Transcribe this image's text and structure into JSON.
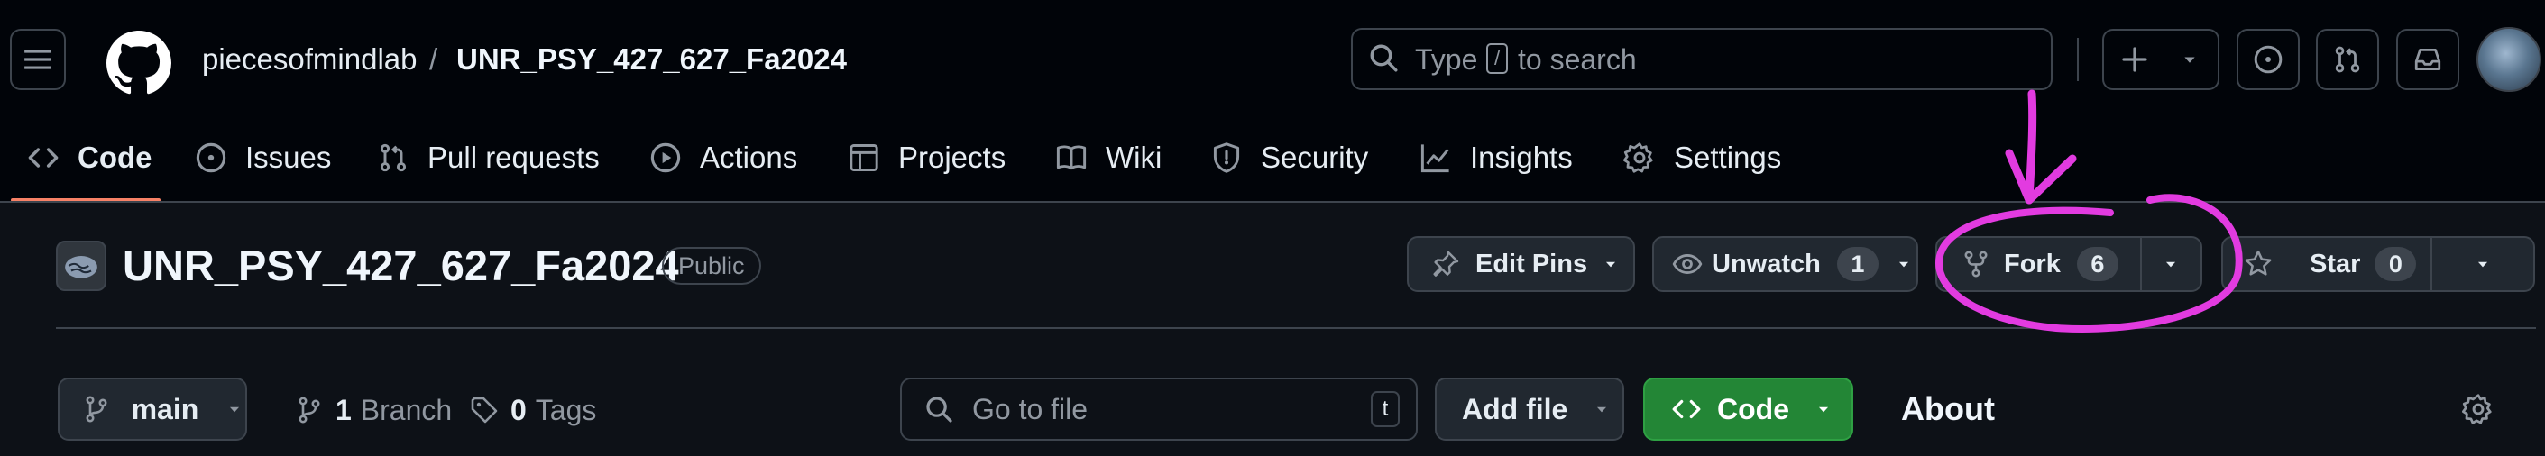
{
  "header": {
    "owner": "piecesofmindlab",
    "separator": "/",
    "repo": "UNR_PSY_427_627_Fa2024",
    "search": {
      "text_before": "Type",
      "key": "/",
      "text_after": "to search"
    },
    "buttons": [
      "hamburger-menu-icon",
      "plus-icon",
      "issue-opened-icon",
      "git-pull-request-icon",
      "inbox-icon"
    ]
  },
  "nav": {
    "tabs": [
      {
        "label": "Code",
        "icon": "code-icon",
        "selected": true
      },
      {
        "label": "Issues",
        "icon": "issue-opened-icon"
      },
      {
        "label": "Pull requests",
        "icon": "git-pull-request-icon"
      },
      {
        "label": "Actions",
        "icon": "play-icon"
      },
      {
        "label": "Projects",
        "icon": "table-icon"
      },
      {
        "label": "Wiki",
        "icon": "book-icon"
      },
      {
        "label": "Security",
        "icon": "shield-icon"
      },
      {
        "label": "Insights",
        "icon": "graph-icon"
      },
      {
        "label": "Settings",
        "icon": "gear-icon"
      }
    ]
  },
  "repo": {
    "name": "UNR_PSY_427_627_Fa2024",
    "visibility": "Public",
    "actions": {
      "edit_pins": "Edit Pins",
      "unwatch": "Unwatch",
      "watchers": "1",
      "fork": "Fork",
      "forks": "6",
      "star": "Star",
      "stars": "0"
    }
  },
  "files": {
    "branch": "main",
    "branch_count": "1",
    "branch_label": "Branch",
    "tag_count": "0",
    "tag_label": "Tags",
    "goto_placeholder": "Go to file",
    "goto_key": "t",
    "add_file": "Add file",
    "code": "Code",
    "about": "About"
  },
  "colors": {
    "background": "#0d1117",
    "header_bg": "#010409",
    "border": "#3d444d",
    "code_button": "#238636",
    "tab_underline": "#f78166",
    "annotation_magenta": "#e23be0"
  }
}
